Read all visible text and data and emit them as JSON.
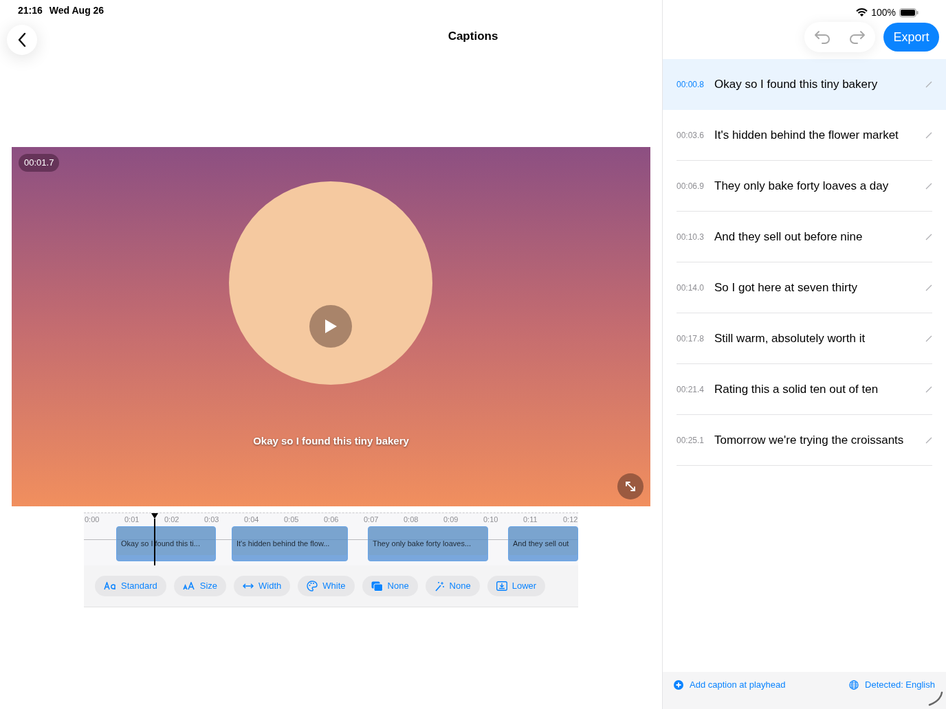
{
  "status_bar": {
    "time": "21:16",
    "date": "Wed Aug 26",
    "battery": "100%"
  },
  "title": "Captions",
  "video": {
    "timestamp": "00:01.7",
    "caption": "Okay so I found this tiny bakery"
  },
  "timeline": {
    "ticks": [
      "0:00",
      "0:01",
      "0:02",
      "0:03",
      "0:04",
      "0:05",
      "0:06",
      "0:07",
      "0:08",
      "0:09",
      "0:10",
      "0:11",
      "0:12"
    ],
    "clips": [
      {
        "text": "Okay so I found this ti..."
      },
      {
        "text": "It's hidden behind the flow..."
      },
      {
        "text": "They only bake forty loaves..."
      },
      {
        "text": "And they sell out"
      }
    ]
  },
  "style_options": [
    {
      "kind": "font",
      "label": "Standard"
    },
    {
      "kind": "size",
      "label": "Size"
    },
    {
      "kind": "width",
      "label": "Width"
    },
    {
      "kind": "color",
      "label": "White"
    },
    {
      "kind": "background",
      "label": "None"
    },
    {
      "kind": "effect",
      "label": "None"
    },
    {
      "kind": "position",
      "label": "Lower"
    }
  ],
  "export_button": "Export",
  "captions": [
    {
      "time": "00:00.8",
      "text": "Okay so I found this tiny bakery",
      "selected": true
    },
    {
      "time": "00:03.6",
      "text": "It's hidden behind the flower market",
      "selected": false
    },
    {
      "time": "00:06.9",
      "text": "They only bake forty loaves a day",
      "selected": false
    },
    {
      "time": "00:10.3",
      "text": "And they sell out before nine",
      "selected": false
    },
    {
      "time": "00:14.0",
      "text": "So I got here at seven thirty",
      "selected": false
    },
    {
      "time": "00:17.8",
      "text": "Still warm, absolutely worth it",
      "selected": false
    },
    {
      "time": "00:21.4",
      "text": "Rating this a solid ten out of ten",
      "selected": false
    },
    {
      "time": "00:25.1",
      "text": "Tomorrow we're trying the croissants",
      "selected": false
    }
  ],
  "footer": {
    "add_caption": "Add caption at playhead",
    "language": "Detected: English"
  }
}
